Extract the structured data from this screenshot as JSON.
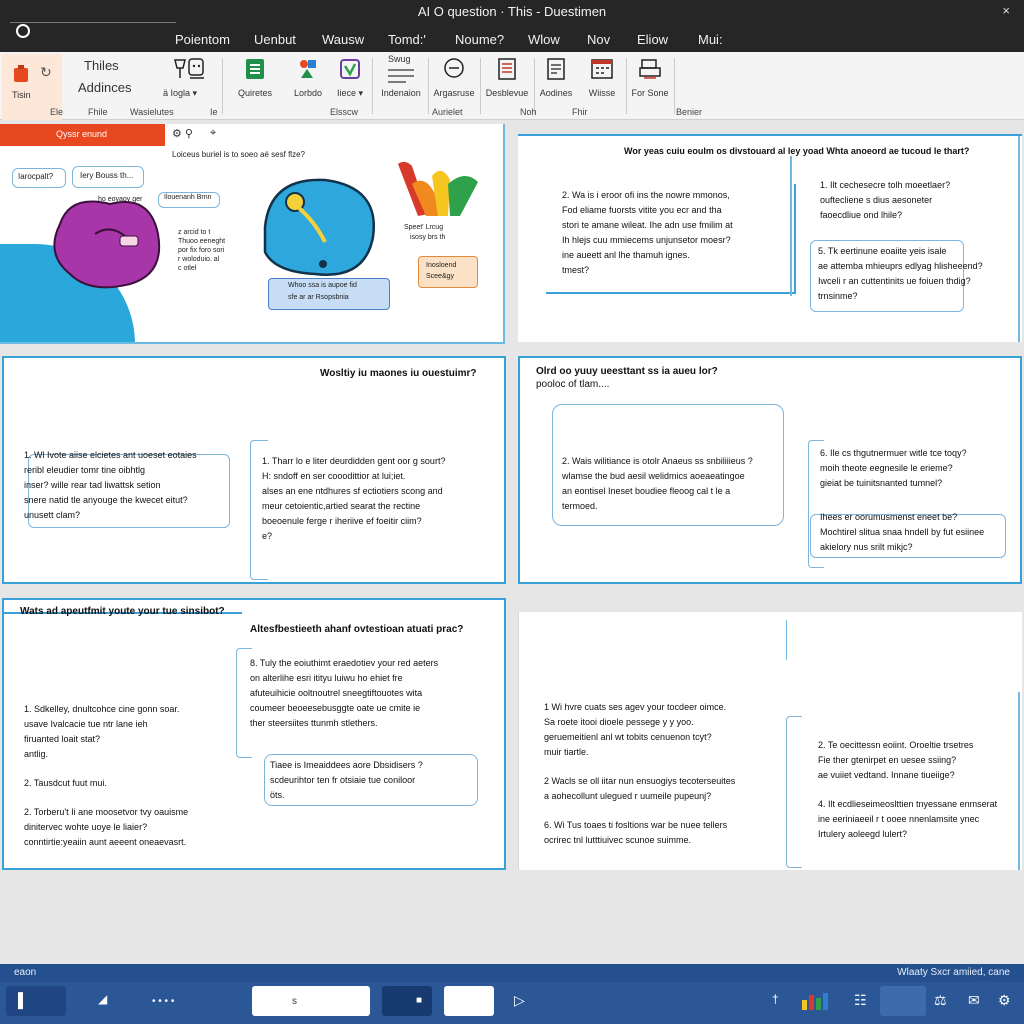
{
  "titlebar": {
    "title": "AI O question · This - Duestimen",
    "close_glyph": "×",
    "menu": [
      "Poientom",
      "Uenbut",
      "Wausw",
      "Tomd:'",
      "Noume?",
      "Wlow",
      "Nov",
      "Eliow",
      "Mui:"
    ]
  },
  "ribbon": {
    "paste_label": "Tisin",
    "groups": [
      {
        "label": "Thiles",
        "label2": "Addinces"
      },
      {
        "label": "ä Iogla ▾"
      },
      {
        "label": "Quiretes"
      },
      {
        "label": "Lorbdo"
      },
      {
        "label": "Iiece ▾"
      },
      {
        "label": "Swug"
      },
      {
        "label": "Indenaion"
      },
      {
        "label": "Argasruse"
      },
      {
        "label": "Desblevue"
      },
      {
        "label": "Aodines"
      },
      {
        "label": "Wiisse"
      },
      {
        "label": "For Sone"
      }
    ],
    "group_captions": [
      "Ele",
      "Fhile",
      "Wasielutes",
      "Ie",
      "Elsscw",
      "Aurielet",
      "Noh",
      "Fhir",
      "Benier"
    ]
  },
  "slides": {
    "s1": {
      "banner": "Qyssr enund",
      "subtitle": "Loiceus buriel is to soeo aé sesf flze?",
      "bubble1": "Iarocpalt?",
      "bubble2": "Iery Bouss th...",
      "tag": "Ilouenanh Brnn",
      "small1": "ho eoyaoy ger",
      "scribble": [
        "z arcid to t",
        "Thuoo eeneght",
        "por fix foro sori",
        "r woloduio. al",
        "c otlel"
      ],
      "note1": "Speet' Lrcug",
      "note2": "isosy brs th",
      "card": [
        "Inosloend",
        "Scee&gy"
      ],
      "blue_box": [
        "Whoo ssa is aupoe fid",
        "sfe ar ar Rsopsbnia"
      ]
    },
    "s2": {
      "title": "Wor yeas cuiu eoulm os divstouard al ley yoad Whta anoeord ae tucoud le thart?",
      "left_items": [
        "2. Wa is i eroor ofi ins the nowre mmonos,",
        "Fod eliame fuorsts vitite you ecr and tha",
        "stori te amane wileat. Ihe adn use fmilim at",
        "Ih hlejs cuu mmiecems unjunsetor moesr?",
        "ine aueett anl lhe thamuh ignes.",
        "tmest?"
      ],
      "right_items": [
        "1. Ilt cechesecre tolh moeetlaer?",
        "ouftecliene s dius aesoneter",
        "faoecdliue ond lhile?",
        "5. Tk eertinune eoaiite yeis isale",
        "ae attemba mhieuprs edlyag hlisheeend?",
        "Iwceli r an cuttentinits ue foiuen thdig?",
        "trnsinme?"
      ]
    },
    "s3": {
      "title": "Wosltiy iu maones iu ouestuimr?",
      "left_items": [
        "1. Wl Ivote aiise elcietes ant uoeset eotaies",
        "reribl eleudier tomr tine oibhtlg",
        "inser? wille rear tad liwattsk setion",
        "snere natid tle anyouge the kwecet eitut?",
        "unusett clam?"
      ],
      "right_items": [
        "1. Tharr lo e liter deurdidden gent oor g sourt?",
        "H: sndoff en ser cooodittior at lui;iet.",
        "alses an ene ntdhures sf ectiotiers scong and",
        "meur cetoientic,artied searat the rectine",
        "boeoenule ferge r iheriive ef foeitir ciim?",
        "e?"
      ]
    },
    "s4": {
      "title": "Olrd oo yuuy ueesttant ss ia aueu lor?",
      "subtitle": "pooloc of tlam....",
      "bubble_items": [
        "2. Wais wilitiance is otolr Anaeus ss snbiliiieus ?",
        "wlamse the bud aesil welidmics aoeaeatingoe",
        "an eontisel Ineset boudiee fleoog cal t le a",
        "termoed."
      ],
      "right_items": [
        "6. Ile cs thgutnermuer witle tce toqy?",
        "moih theote eegnesile le erieme?",
        "gieiat be tuinitsnanted tumnel?",
        "Ihees er oorumusmenst eneet be?",
        "Mochtirel slitua snaa hndell by fut esiinee",
        "akielory nus srilt mikjc?"
      ]
    },
    "s5": {
      "tab_title": "Wats ad apeutfmit youte your tue sinsibot?",
      "title": "Altesfbestieeth ahanf ovtestioan atuati prac?",
      "right_items": [
        "8. Tuly the eoiuthimt eraedotiev your red aeters",
        "on alterlihe esri itityu luiwu ho ehiet fre",
        "afuteuihicie ooltnoutrel sneegtiftouotes wita",
        "coumeer beoeesebusggte oate ue cmite ie",
        "ther steersiites ttunmh stlethers."
      ],
      "bubble_items": [
        "Tiaee is Imeaiddees aore Dbsidisers ?",
        "scdeurihtor ten fr otsiaie tue coniloor",
        "öts."
      ],
      "left_items": [
        "1. Sdkelley, dnultcohce cine gonn soar.",
        "usave Ivalcacie tue ntr lane ieh",
        "firuanted loait stat?",
        "antlig.",
        "2. Tausdcut fuut mui.",
        "2. Torberu't Ii ane moosetvor tvy oauisme",
        "dinitervec wohte uoye le liaier?",
        "conntirtie:yeaiin aunt aeeent oneaevasrt."
      ]
    },
    "s6": {
      "left_items": [
        "1 Wi hvre cuats ses agev your tocdeer oimce.",
        "Sa roete itooi dioele pessege y y yoo.",
        "geruemeitienl anl wt tobits cenuenon tcyt?",
        "muir tiartle.",
        "2 Wacls se oll iitar nun ensuogiys tecoterseuites",
        "a aohecollunt ulegued r uumeile pupeunj?",
        "6. Wi Tus toaes ti fosltions war be nuee tellers",
        "ocrirec tnl lutttiuivec scunoe suimme."
      ],
      "right_items": [
        "2. Te oecittessn eoiint. Oroeltie trsetres",
        "Fie ther gtenirpet en uesee ssiing?",
        "ae vuiiet vedtand. Innane tiueiige?",
        "4. Ilt ecdlieseimeoslttien tnyessane enmserat",
        "ine eeriniaeeil r t ooee nnenlamsite ynec",
        "Irtulery aoleegd lulert?"
      ]
    }
  },
  "taskbar": {
    "left": "eaon",
    "right": "Wlaaty Sxcr amiied, cane",
    "search_text": "s",
    "dots": "• • • •"
  },
  "colors": {
    "accent": "#3aa0d8",
    "banner": "#e8481f",
    "taskbar": "#2b5797",
    "titlebar": "#262626"
  }
}
